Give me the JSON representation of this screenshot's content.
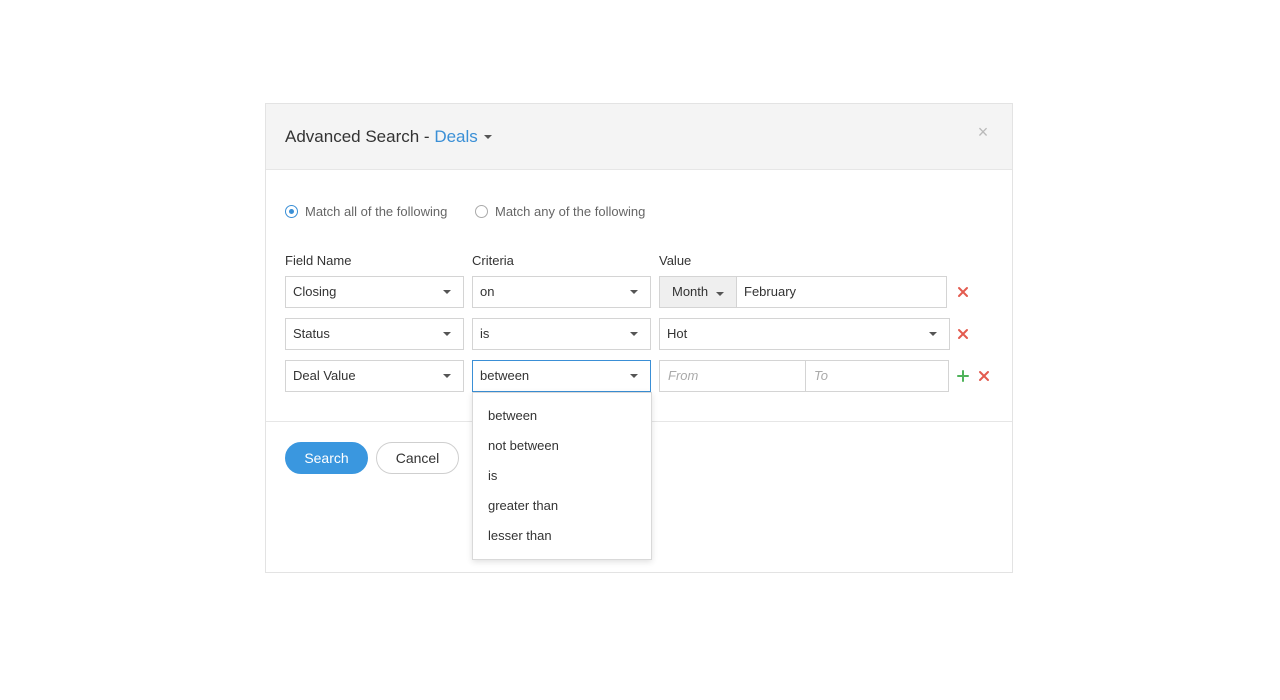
{
  "dialog": {
    "title_prefix": "Advanced Search - ",
    "module": "Deals",
    "close_label": "×"
  },
  "match": {
    "all_label": "Match all of the following",
    "any_label": "Match any of the following",
    "selected": "all"
  },
  "columns": {
    "field_name": "Field Name",
    "criteria": "Criteria",
    "value": "Value"
  },
  "rows": [
    {
      "field": "Closing",
      "criteria": "on",
      "value_type": "month",
      "unit": "Month",
      "value": "February"
    },
    {
      "field": "Status",
      "criteria": "is",
      "value_type": "select",
      "value": "Hot"
    },
    {
      "field": "Deal Value",
      "criteria": "between",
      "value_type": "range",
      "from_placeholder": "From",
      "to_placeholder": "To"
    }
  ],
  "criteria_dropdown": {
    "options": [
      "between",
      "not between",
      "is",
      "greater than",
      "lesser than"
    ]
  },
  "buttons": {
    "search": "Search",
    "cancel": "Cancel"
  },
  "colors": {
    "accent": "#3a8fd6",
    "primary_button": "#3a97df",
    "remove_icon": "#e35b4f",
    "add_icon": "#4fb35a"
  },
  "icons": {
    "remove": "close-icon",
    "add": "plus-icon",
    "caret": "chevron-down-icon"
  }
}
